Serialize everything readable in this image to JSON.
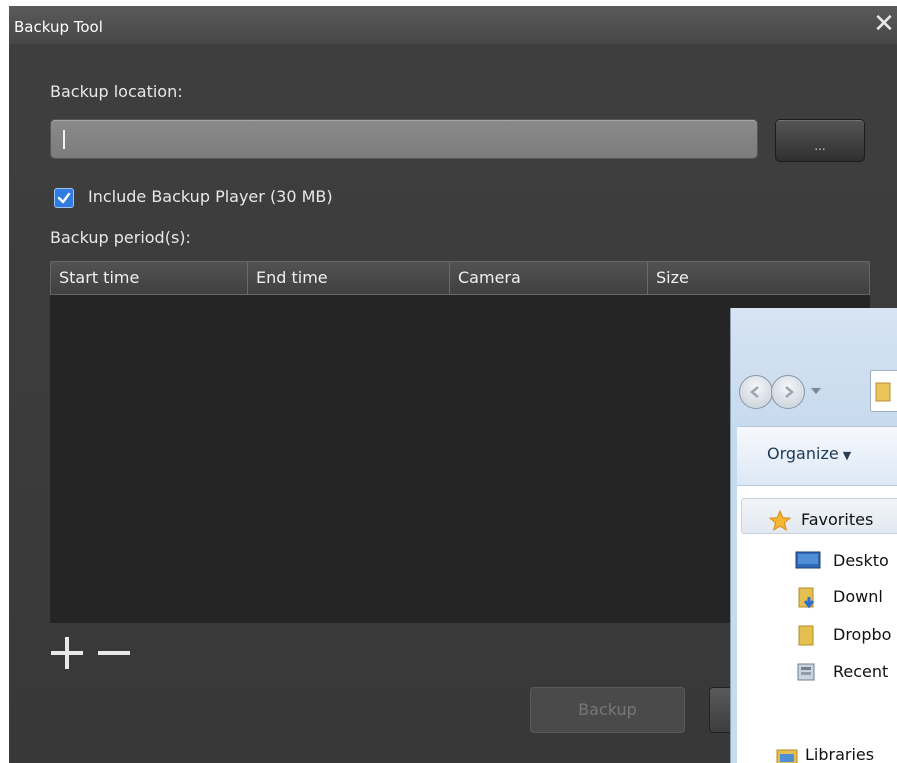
{
  "dialog": {
    "title": "Backup Tool",
    "close_glyph": "✕",
    "backup_location_label": "Backup location:",
    "backup_location_value": "",
    "browse_label": "...",
    "include_player_label": "Include Backup Player (30 MB)",
    "include_player_checked": true,
    "periods_label": "Backup period(s):",
    "table": {
      "columns": [
        "Start time",
        "End time",
        "Camera",
        "Size"
      ],
      "rows": []
    },
    "backup_button_label": "Backup",
    "accent_color": "#2f7be0"
  },
  "explorer": {
    "organize_label": "Organize",
    "caret_glyph": "▼",
    "nav": {
      "favorites": "Favorites",
      "items": [
        {
          "label": "Deskto",
          "icon": "desktop-icon"
        },
        {
          "label": "Downl",
          "icon": "downloads-folder-icon"
        },
        {
          "label": "Dropbo",
          "icon": "folder-icon"
        },
        {
          "label": "Recent",
          "icon": "recent-places-icon"
        }
      ],
      "libraries": "Libraries"
    }
  }
}
